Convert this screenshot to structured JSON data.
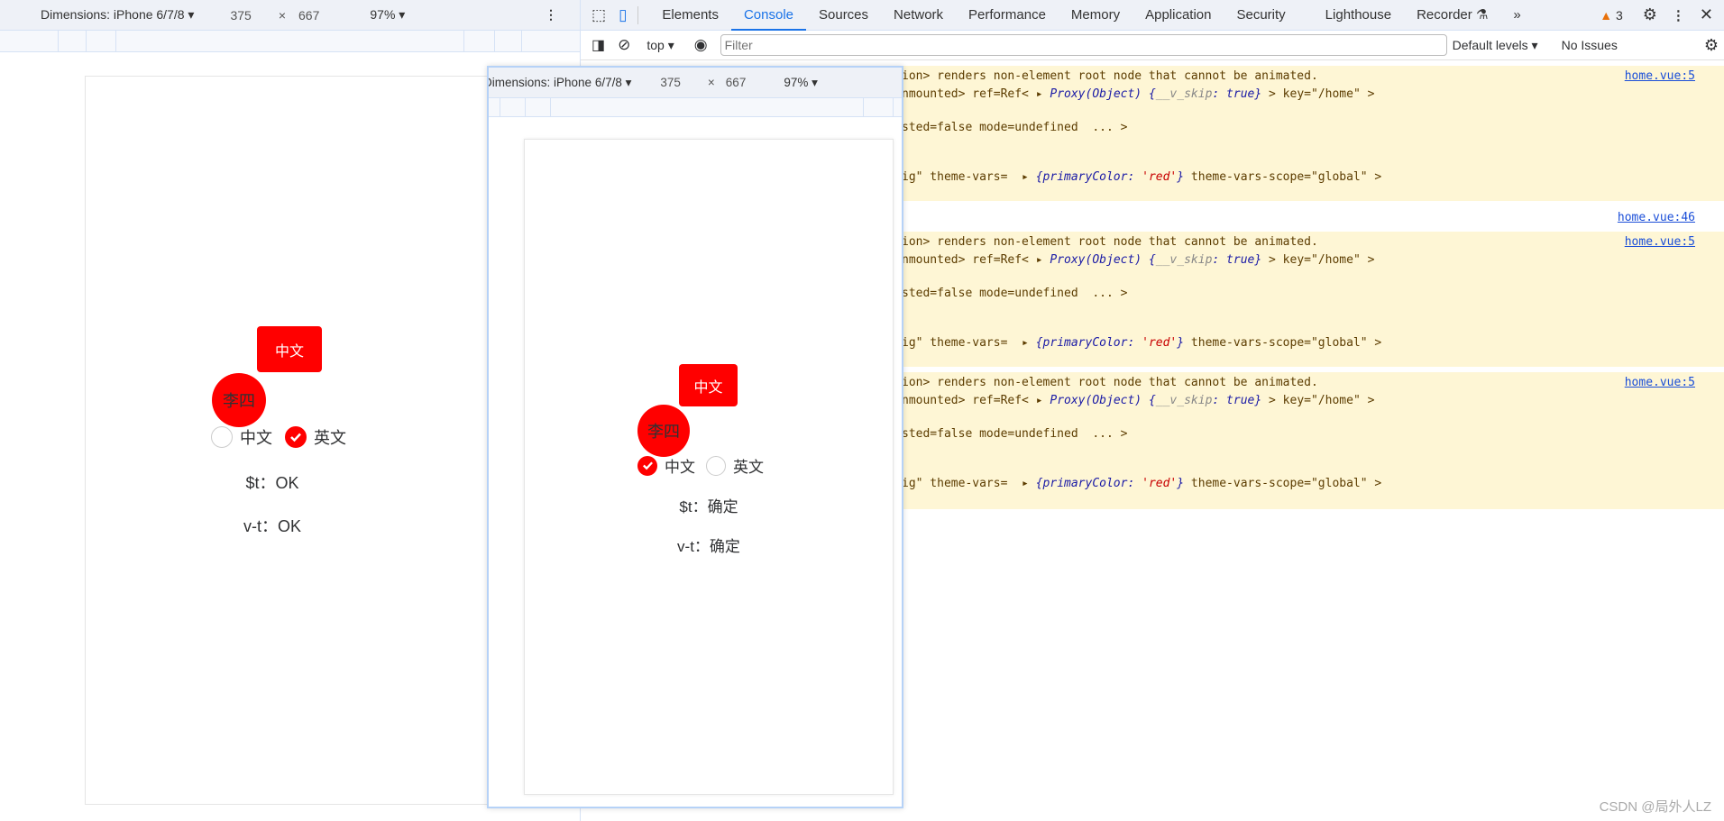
{
  "device_toolbar": {
    "device": "Dimensions: iPhone 6/7/8 ▾",
    "width": "375",
    "x": "×",
    "height": "667",
    "zoom": "97% ▾"
  },
  "left_app": {
    "button": "中文",
    "avatar": "李四",
    "radio_zh": "中文",
    "radio_en": "英文",
    "selected": "英文",
    "t_line": "$t：OK",
    "vt_line": "v-t：OK"
  },
  "right_app": {
    "button": "中文",
    "avatar": "李四",
    "radio_zh": "中文",
    "radio_en": "英文",
    "selected": "中文",
    "t_line": "$t：确定",
    "vt_line": "v-t：确定"
  },
  "devtools": {
    "tabs": [
      "Elements",
      "Console",
      "Sources",
      "Network",
      "Performance",
      "Memory",
      "Application",
      "Security",
      "Lighthouse",
      "Recorder ⚗",
      "»"
    ],
    "active_tab": "Console",
    "warnings": "3",
    "context": "top ▾",
    "filter_placeholder": "Filter",
    "levels": "Default levels ▾",
    "issues": "No Issues",
    "messages": [
      {
        "l1": "ion> renders non-element root node that cannot be animated.",
        "l2a": "nmounted> ref=Ref< ▸ ",
        "l2b": "Proxy(Object) {",
        "l2c": "__v_skip",
        "l2d": ": true}",
        "l2e": " > key=\"/home\" >",
        "l3": "sted=false mode=undefined  ... >",
        "l4a": "ig\" theme-vars=  ▸ ",
        "l4b": "{primaryColor: ",
        "l4c": "'red'",
        "l4d": "}",
        "l4e": " theme-vars-scope=\"global\" >",
        "source": "home.vue:5"
      },
      {
        "l1": "ion> renders non-element root node that cannot be animated.",
        "l2a": "nmounted> ref=Ref< ▸ ",
        "l2b": "Proxy(Object) {",
        "l2c": "__v_skip",
        "l2d": ": true}",
        "l2e": " > key=\"/home\" >",
        "l3": "sted=false mode=undefined  ... >",
        "l4a": "ig\" theme-vars=  ▸ ",
        "l4b": "{primaryColor: ",
        "l4c": "'red'",
        "l4d": "}",
        "l4e": " theme-vars-scope=\"global\" >",
        "source": "home.vue:5"
      },
      {
        "l1": "ion> renders non-element root node that cannot be animated.",
        "l2a": "nmounted> ref=Ref< ▸ ",
        "l2b": "Proxy(Object) {",
        "l2c": "__v_skip",
        "l2d": ": true}",
        "l2e": " > key=\"/home\" >",
        "l3": "sted=false mode=undefined  ... >",
        "l4a": "ig\" theme-vars=  ▸ ",
        "l4b": "{primaryColor: ",
        "l4c": "'red'",
        "l4d": "}",
        "l4e": " theme-vars-scope=\"global\" >",
        "source": "home.vue:5"
      }
    ],
    "log_source": "home.vue:46"
  },
  "watermark": "CSDN @局外人LZ",
  "colors": {
    "accent": "#ff0000",
    "devtools_blue": "#1a73e8",
    "warning_bg": "#fef6d5"
  }
}
